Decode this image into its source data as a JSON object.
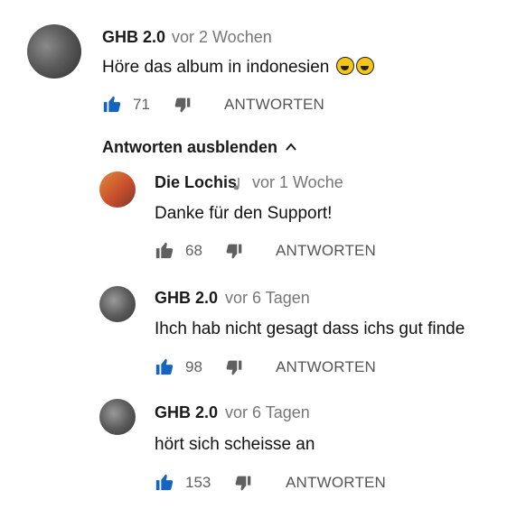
{
  "comment": {
    "author": "GHB 2.0",
    "time": "vor 2 Wochen",
    "text": "Höre das album in indonesien",
    "emoji_count": 2,
    "likes": "71",
    "reply_label": "ANTWORTEN",
    "liked": true
  },
  "hide_replies_label": "Antworten ausblenden",
  "replies": [
    {
      "author": "Die Lochis",
      "badge_icon": "music-note-icon",
      "time": "vor 1 Woche",
      "text": "Danke für den Support!",
      "likes": "68",
      "reply_label": "ANTWORTEN",
      "liked": false
    },
    {
      "author": "GHB 2.0",
      "time": "vor 6 Tagen",
      "text": "Ihch hab nicht gesagt dass ichs gut finde",
      "likes": "98",
      "reply_label": "ANTWORTEN",
      "liked": true
    },
    {
      "author": "GHB 2.0",
      "time": "vor 6 Tagen",
      "text": "hört sich scheisse an",
      "likes": "153",
      "reply_label": "ANTWORTEN",
      "liked": true
    }
  ],
  "colors": {
    "like_active": "#1565c0",
    "like_inactive": "#606060",
    "muted_text": "#767676"
  }
}
